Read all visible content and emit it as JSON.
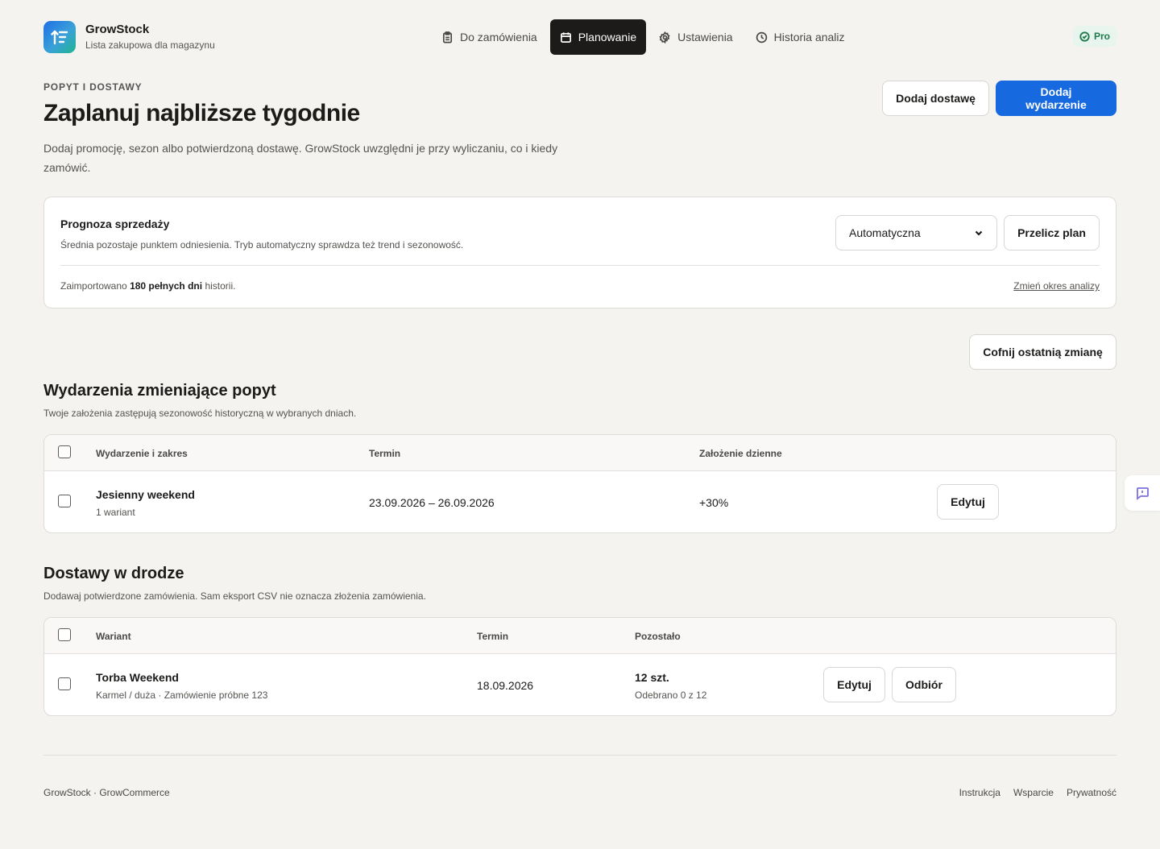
{
  "brand": {
    "name": "GrowStock",
    "subtitle": "Lista zakupowa dla magazynu"
  },
  "nav": {
    "items": [
      {
        "label": "Do zamówienia",
        "icon": "clipboard-icon",
        "active": false
      },
      {
        "label": "Planowanie",
        "icon": "calendar-icon",
        "active": true
      },
      {
        "label": "Ustawienia",
        "icon": "gear-icon",
        "active": false
      },
      {
        "label": "Historia analiz",
        "icon": "clock-icon",
        "active": false
      }
    ],
    "badge": "Pro"
  },
  "hero": {
    "eyebrow": "POPYT I DOSTAWY",
    "title": "Zaplanuj najbliższe tygodnie",
    "description": "Dodaj promocję, sezon albo potwierdzoną dostawę. GrowStock uwzględni je przy wyliczaniu, co i kiedy zamówić.",
    "add_delivery_label": "Dodaj dostawę",
    "add_event_label": "Dodaj wydarzenie"
  },
  "forecast": {
    "title": "Prognoza sprzedaży",
    "description": "Średnia pozostaje punktem odniesienia. Tryb automatyczny sprawdza też trend i sezonowość.",
    "mode_selected": "Automatyczna",
    "recalc_label": "Przelicz plan",
    "note_prefix": "Zaimportowano",
    "note_bold": "180 pełnych dni",
    "note_suffix": "historii.",
    "change_period_label": "Zmień okres analizy"
  },
  "undo_label": "Cofnij ostatnią zmianę",
  "events": {
    "title": "Wydarzenia zmieniające popyt",
    "subtitle": "Twoje założenia zastępują sezonowość historyczną w wybranych dniach.",
    "columns": [
      "Wydarzenie i zakres",
      "Termin",
      "Założenie dzienne"
    ],
    "rows": [
      {
        "name": "Jesienny weekend",
        "scope": "1 wariant",
        "term": "23.09.2026 – 26.09.2026",
        "assumption": "+30%",
        "edit_label": "Edytuj"
      }
    ]
  },
  "deliveries": {
    "title": "Dostawy w drodze",
    "subtitle": "Dodawaj potwierdzone zamówienia. Sam eksport CSV nie oznacza złożenia zamówienia.",
    "columns": [
      "Wariant",
      "Termin",
      "Pozostało"
    ],
    "rows": [
      {
        "name": "Torba Weekend",
        "detail": "Karmel / duża · Zamówienie próbne 123",
        "term": "18.09.2026",
        "remaining": "12 szt.",
        "received": "Odebrano 0 z 12",
        "edit_label": "Edytuj",
        "pickup_label": "Odbiór"
      }
    ]
  },
  "footer": {
    "left": "GrowStock · GrowCommerce",
    "links": [
      "Instrukcja",
      "Wsparcie",
      "Prywatność"
    ]
  },
  "colors": {
    "accent": "#1769e0",
    "active_nav": "#1c1b1a",
    "pro_badge_bg": "#e8f5ee",
    "pro_badge_text": "#1e7a4b"
  }
}
